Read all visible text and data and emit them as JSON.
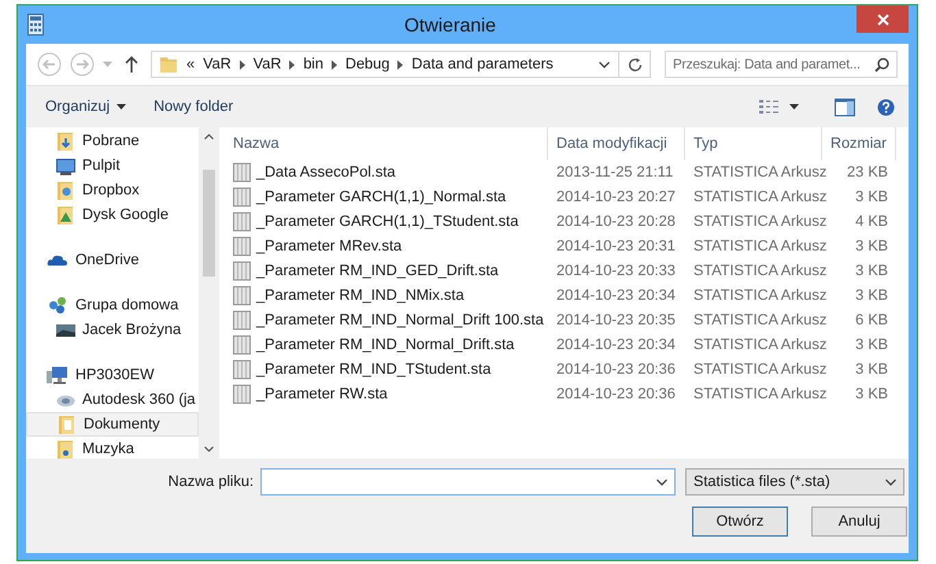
{
  "window": {
    "title": "Otwieranie"
  },
  "address": {
    "overflow": "«",
    "crumbs": [
      "VaR",
      "VaR",
      "bin",
      "Debug",
      "Data and parameters"
    ]
  },
  "search": {
    "placeholder": "Przeszukaj: Data and paramet..."
  },
  "toolbar": {
    "organize": "Organizuj",
    "new_folder": "Nowy folder"
  },
  "sidebar": {
    "sections": [
      {
        "children": [
          {
            "label": "Pobrane",
            "kind": "download",
            "selected": false
          },
          {
            "label": "Pulpit",
            "kind": "desktop",
            "selected": false
          },
          {
            "label": "Dropbox",
            "kind": "dropbox",
            "selected": false
          },
          {
            "label": "Dysk Google",
            "kind": "gdrive",
            "selected": false
          }
        ]
      },
      {
        "label": "OneDrive",
        "kind": "cloud"
      },
      {
        "label": "Grupa domowa",
        "kind": "homegroup",
        "children": [
          {
            "label": "Jacek Brożyna",
            "kind": "user",
            "selected": false
          }
        ]
      },
      {
        "label": "HP3030EW",
        "kind": "computer",
        "children": [
          {
            "label": "Autodesk 360 (ja",
            "kind": "autodesk",
            "selected": false
          },
          {
            "label": "Dokumenty",
            "kind": "documents",
            "selected": true
          },
          {
            "label": "Muzyka",
            "kind": "music",
            "selected": false
          }
        ]
      }
    ]
  },
  "table": {
    "columns": [
      "Nazwa",
      "Data modyfikacji",
      "Typ",
      "Rozmiar"
    ],
    "rows": [
      [
        "_Data AssecoPol.sta",
        "2013-11-25 21:11",
        "STATISTICA Arkusz",
        "23 KB"
      ],
      [
        "_Parameter GARCH(1,1)_Normal.sta",
        "2014-10-23 20:27",
        "STATISTICA Arkusz",
        "3 KB"
      ],
      [
        "_Parameter GARCH(1,1)_TStudent.sta",
        "2014-10-23 20:28",
        "STATISTICA Arkusz",
        "4 KB"
      ],
      [
        "_Parameter MRev.sta",
        "2014-10-23 20:31",
        "STATISTICA Arkusz",
        "3 KB"
      ],
      [
        "_Parameter RM_IND_GED_Drift.sta",
        "2014-10-23 20:33",
        "STATISTICA Arkusz",
        "3 KB"
      ],
      [
        "_Parameter RM_IND_NMix.sta",
        "2014-10-23 20:34",
        "STATISTICA Arkusz",
        "3 KB"
      ],
      [
        "_Parameter RM_IND_Normal_Drift 100.sta",
        "2014-10-23 20:35",
        "STATISTICA Arkusz",
        "6 KB"
      ],
      [
        "_Parameter RM_IND_Normal_Drift.sta",
        "2014-10-23 20:34",
        "STATISTICA Arkusz",
        "3 KB"
      ],
      [
        "_Parameter RM_IND_TStudent.sta",
        "2014-10-23 20:36",
        "STATISTICA Arkusz",
        "3 KB"
      ],
      [
        "_Parameter RW.sta",
        "2014-10-23 20:36",
        "STATISTICA Arkusz",
        "3 KB"
      ]
    ]
  },
  "footer": {
    "filename_label": "Nazwa pliku:",
    "filter": "Statistica files (*.sta)",
    "open": "Otwórz",
    "cancel": "Anuluj"
  }
}
